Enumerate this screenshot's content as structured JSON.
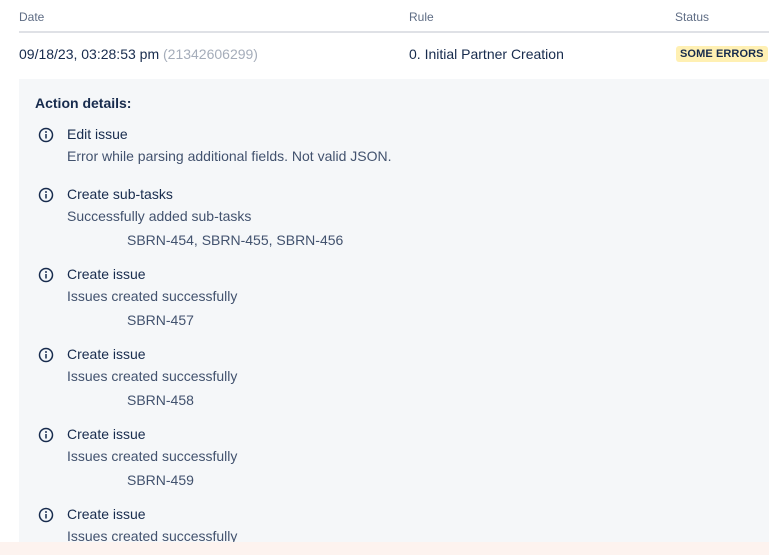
{
  "table": {
    "headers": {
      "date": "Date",
      "rule": "Rule",
      "status": "Status"
    },
    "row": {
      "date": "09/18/23, 03:28:53 pm",
      "execution_id": "(21342606299)",
      "rule": "0. Initial Partner Creation",
      "status": "SOME ERRORS"
    }
  },
  "details": {
    "title": "Action details:",
    "actions": [
      {
        "icon": "info-icon",
        "name": "Edit issue",
        "message": "Error while parsing additional fields. Not valid JSON.",
        "issues": ""
      },
      {
        "icon": "info-icon",
        "name": "Create sub-tasks",
        "message": "Successfully added sub-tasks",
        "issues": "SBRN-454, SBRN-455, SBRN-456"
      },
      {
        "icon": "info-icon",
        "name": "Create issue",
        "message": "Issues created successfully",
        "issues": "SBRN-457"
      },
      {
        "icon": "info-icon",
        "name": "Create issue",
        "message": "Issues created successfully",
        "issues": "SBRN-458"
      },
      {
        "icon": "info-icon",
        "name": "Create issue",
        "message": "Issues created successfully",
        "issues": "SBRN-459"
      },
      {
        "icon": "info-icon",
        "name": "Create issue",
        "message": "Issues created successfully",
        "issues": ""
      }
    ]
  },
  "colors": {
    "status_badge_bg": "#fff0b3",
    "details_bg": "#f5f7f9",
    "text_primary": "#172b4d",
    "text_secondary": "#42526e",
    "text_muted": "#a5adba"
  }
}
